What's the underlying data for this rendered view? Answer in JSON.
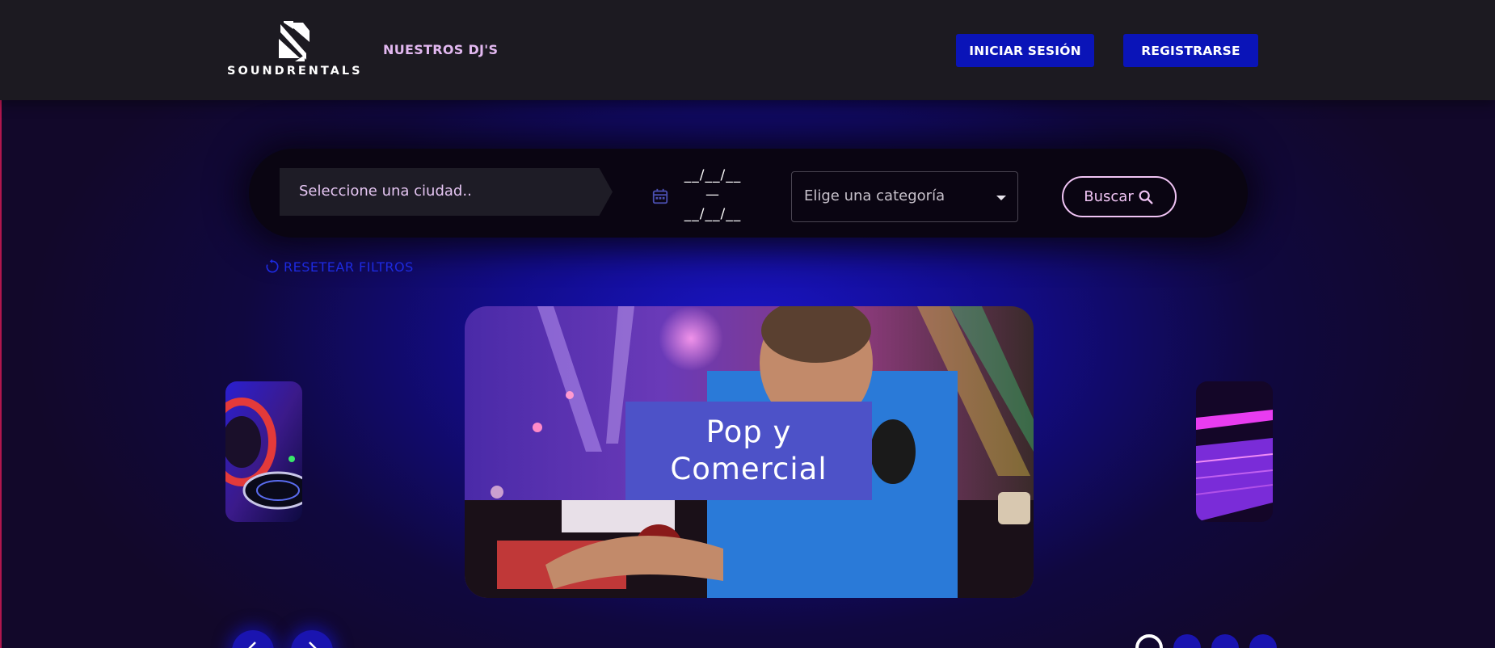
{
  "header": {
    "logo_text": "SOUNDRENTALS",
    "nav_link": "NUESTROS DJ'S",
    "login_label": "INICIAR SESIÓN",
    "register_label": "REGISTRARSE"
  },
  "search": {
    "city_placeholder": "Seleccione una ciudad..",
    "date_start": "__/__/__",
    "date_separator": "—",
    "date_end": "__/__/__",
    "category_placeholder": "Elige una categoría",
    "search_label": "Buscar",
    "reset_label": "RESETEAR FILTROS"
  },
  "carousel": {
    "active_label_line1": "Pop y",
    "active_label_line2": "Comercial",
    "dots_count": 4,
    "active_dot": 1
  },
  "colors": {
    "header_bg": "#1c1a21",
    "button_blue": "#0a14b8",
    "accent_pink": "#e2b8f0",
    "label_bg": "#4d52c8"
  },
  "icons": [
    "logo-mark-icon",
    "calendar-icon",
    "chevron-down-icon",
    "search-icon",
    "reset-icon",
    "chevron-left-icon",
    "chevron-right-icon"
  ]
}
